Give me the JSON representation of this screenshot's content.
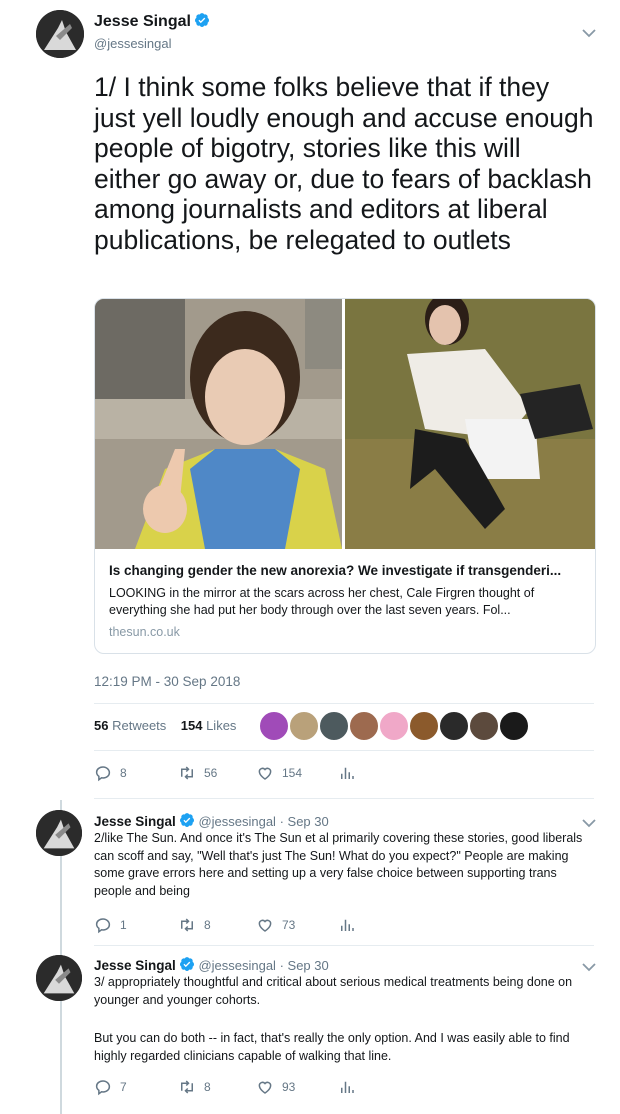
{
  "main_tweet": {
    "author_name": "Jesse Singal",
    "handle": "@jessesingal",
    "text": "1/ I think some folks believe that if they just yell loudly enough and accuse enough people of bigotry, stories like this will either go away or, due to fears of backlash among journalists and editors at liberal publications, be relegated to outlets",
    "card": {
      "title": "Is changing gender the new anorexia? We investigate if transgenderi...",
      "description": "LOOKING in the mirror at the scars across her chest, Cale Firgren thought of everything she had put her body through over the last seven years. Fol...",
      "domain": "thesun.co.uk"
    },
    "timestamp": "12:19 PM - 30 Sep 2018",
    "retweets_count": "56",
    "retweets_label": "Retweets",
    "likes_count": "154",
    "likes_label": "Likes",
    "actions": {
      "replies": "8",
      "retweets": "56",
      "likes": "154"
    }
  },
  "replies": [
    {
      "author_name": "Jesse Singal",
      "handle": "@jessesingal",
      "date": "· Sep 30",
      "text": "2/like The Sun. And once it's The Sun et al primarily covering these stories, good liberals can scoff and say, \"Well that's just The Sun! What do you expect?\" People are making some grave errors here and setting up a very false choice between supporting trans people and being",
      "actions": {
        "replies": "1",
        "retweets": "8",
        "likes": "73"
      }
    },
    {
      "author_name": "Jesse Singal",
      "handle": "@jessesingal",
      "date": "· Sep 30",
      "text_p1": "3/ appropriately thoughtful and critical about serious medical treatments being done on younger and younger cohorts.",
      "text_p2": "But you can do both -- in fact, that's really the only option. And I was easily able to find highly regarded clinicians capable of walking that line.",
      "actions": {
        "replies": "7",
        "retweets": "8",
        "likes": "93"
      }
    }
  ],
  "colors": {
    "verified": "#1da1f2",
    "text": "#14171a",
    "muted": "#657786",
    "border": "#e6ecf0"
  },
  "icons": [
    "verified-badge-icon",
    "chevron-down-icon",
    "reply-icon",
    "retweet-icon",
    "like-icon",
    "analytics-icon"
  ]
}
